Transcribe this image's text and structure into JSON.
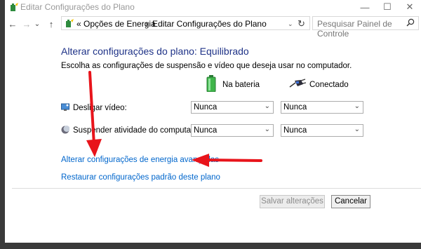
{
  "window": {
    "title": "Editar Configurações do Plano",
    "minimize_glyph": "—",
    "maximize_glyph": "☐",
    "close_glyph": "✕"
  },
  "addressbar": {
    "back_glyph": "←",
    "forward_glyph": "→",
    "recent_glyph": "⌄",
    "up_glyph": "↑",
    "overflow": "«",
    "crumb1": "Opções de Energia",
    "crumb_sep": "›",
    "crumb2": "Editar Configurações do Plano",
    "dropdown_glyph": "⌄",
    "refresh_glyph": "↻",
    "search_placeholder": "Pesquisar Painel de Controle"
  },
  "main": {
    "title": "Alterar configurações do plano: Equilibrado",
    "subtitle": "Escolha as configurações de suspensão e vídeo que deseja usar no computador.",
    "col_battery": "Na bateria",
    "col_plugged": "Conectado",
    "rows": [
      {
        "label": "Desligar vídeo:",
        "battery": "Nunca",
        "plugged": "Nunca"
      },
      {
        "label": "Suspender atividade do computador:",
        "battery": "Nunca",
        "plugged": "Nunca"
      }
    ],
    "link_advanced": "Alterar configurações de energia avançadas",
    "link_restore": "Restaurar configurações padrão deste plano",
    "save_label": "Salvar alterações",
    "cancel_label": "Cancelar"
  },
  "colors": {
    "heading": "#1e3287",
    "link": "#0066cc",
    "arrow": "#e8141b"
  }
}
